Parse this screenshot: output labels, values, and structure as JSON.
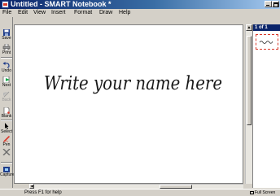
{
  "window": {
    "title": "Untitled - SMART Notebook *"
  },
  "menu": [
    "File",
    "Edit",
    "View",
    "Insert",
    "Format",
    "Draw",
    "Help"
  ],
  "toolbar": {
    "save": "Save",
    "print": "Print",
    "undo": "Undo",
    "next": "Next",
    "back": "Back",
    "blank": "Blank",
    "select": "Select",
    "pen": "Pen",
    "capture": "Capture"
  },
  "canvas": {
    "handwriting": "Write your name here",
    "handwriting_color": "#1a1a1a"
  },
  "page_sorter": {
    "page_indicator": "1 of 1",
    "thumbnail_border_color": "#d93a2b"
  },
  "status": {
    "help_text": "Press F1 for help",
    "fullscreen_label": "Full Screen"
  }
}
